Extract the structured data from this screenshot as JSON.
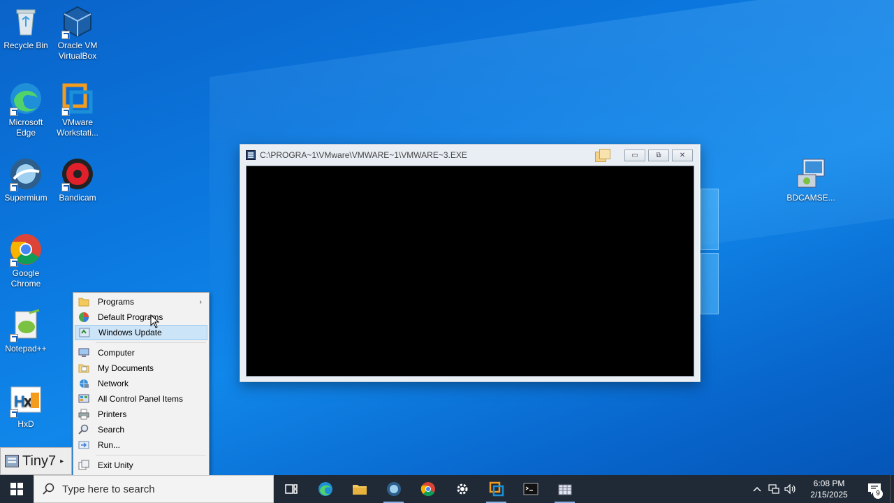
{
  "desktop": {
    "icons": [
      {
        "label": "Recycle Bin",
        "icon": "recycle-bin-icon"
      },
      {
        "label": "Oracle VM VirtualBox",
        "icon": "virtualbox-icon"
      },
      {
        "label": "Microsoft Edge",
        "icon": "edge-icon"
      },
      {
        "label": "VMware Workstati...",
        "icon": "vmware-icon"
      },
      {
        "label": "Supermium",
        "icon": "supermium-icon"
      },
      {
        "label": "Bandicam",
        "icon": "bandicam-icon"
      },
      {
        "label": "Google Chrome",
        "icon": "chrome-icon"
      },
      {
        "label": "Notepad++",
        "icon": "notepadpp-icon"
      },
      {
        "label": "HxD",
        "icon": "hxd-icon"
      },
      {
        "label": "BDCAMSE...",
        "icon": "bdcamsetup-icon"
      }
    ]
  },
  "console_window": {
    "title": "C:\\PROGRA~1\\VMware\\VMWARE~1\\VMWARE~3.EXE",
    "minimize": "▭",
    "maximize": "⧉",
    "close": "✕"
  },
  "context_menu": {
    "items": [
      {
        "label": "Programs",
        "icon": "folder-icon",
        "submenu": true
      },
      {
        "label": "Default Programs",
        "icon": "default-programs-icon"
      },
      {
        "label": "Windows Update",
        "icon": "windows-update-icon",
        "highlighted": true
      },
      {
        "label": "Computer",
        "icon": "computer-icon"
      },
      {
        "label": "My Documents",
        "icon": "documents-icon"
      },
      {
        "label": "Network",
        "icon": "network-icon"
      },
      {
        "label": "All Control Panel Items",
        "icon": "control-panel-icon"
      },
      {
        "label": "Printers",
        "icon": "printer-icon"
      },
      {
        "label": "Search",
        "icon": "search-icon"
      },
      {
        "label": "Run...",
        "icon": "run-icon"
      },
      {
        "label": "Exit Unity",
        "icon": "exit-unity-icon"
      }
    ],
    "submenu_arrow": "›"
  },
  "tiny7_tab": {
    "label": "Tiny7",
    "arrow": "▸"
  },
  "taskbar": {
    "search_placeholder": "Type here to search",
    "apps": [
      "task-view-icon",
      "edge-icon",
      "file-explorer-icon",
      "supermium-icon",
      "chrome-icon",
      "settings-icon",
      "vmware-icon",
      "terminal-icon",
      "vmware-console-icon"
    ],
    "clock_time": "6:08 PM",
    "clock_date": "2/15/2025",
    "notification_count": "9",
    "background": "#1f2a36",
    "accent": "#0b79e0"
  }
}
